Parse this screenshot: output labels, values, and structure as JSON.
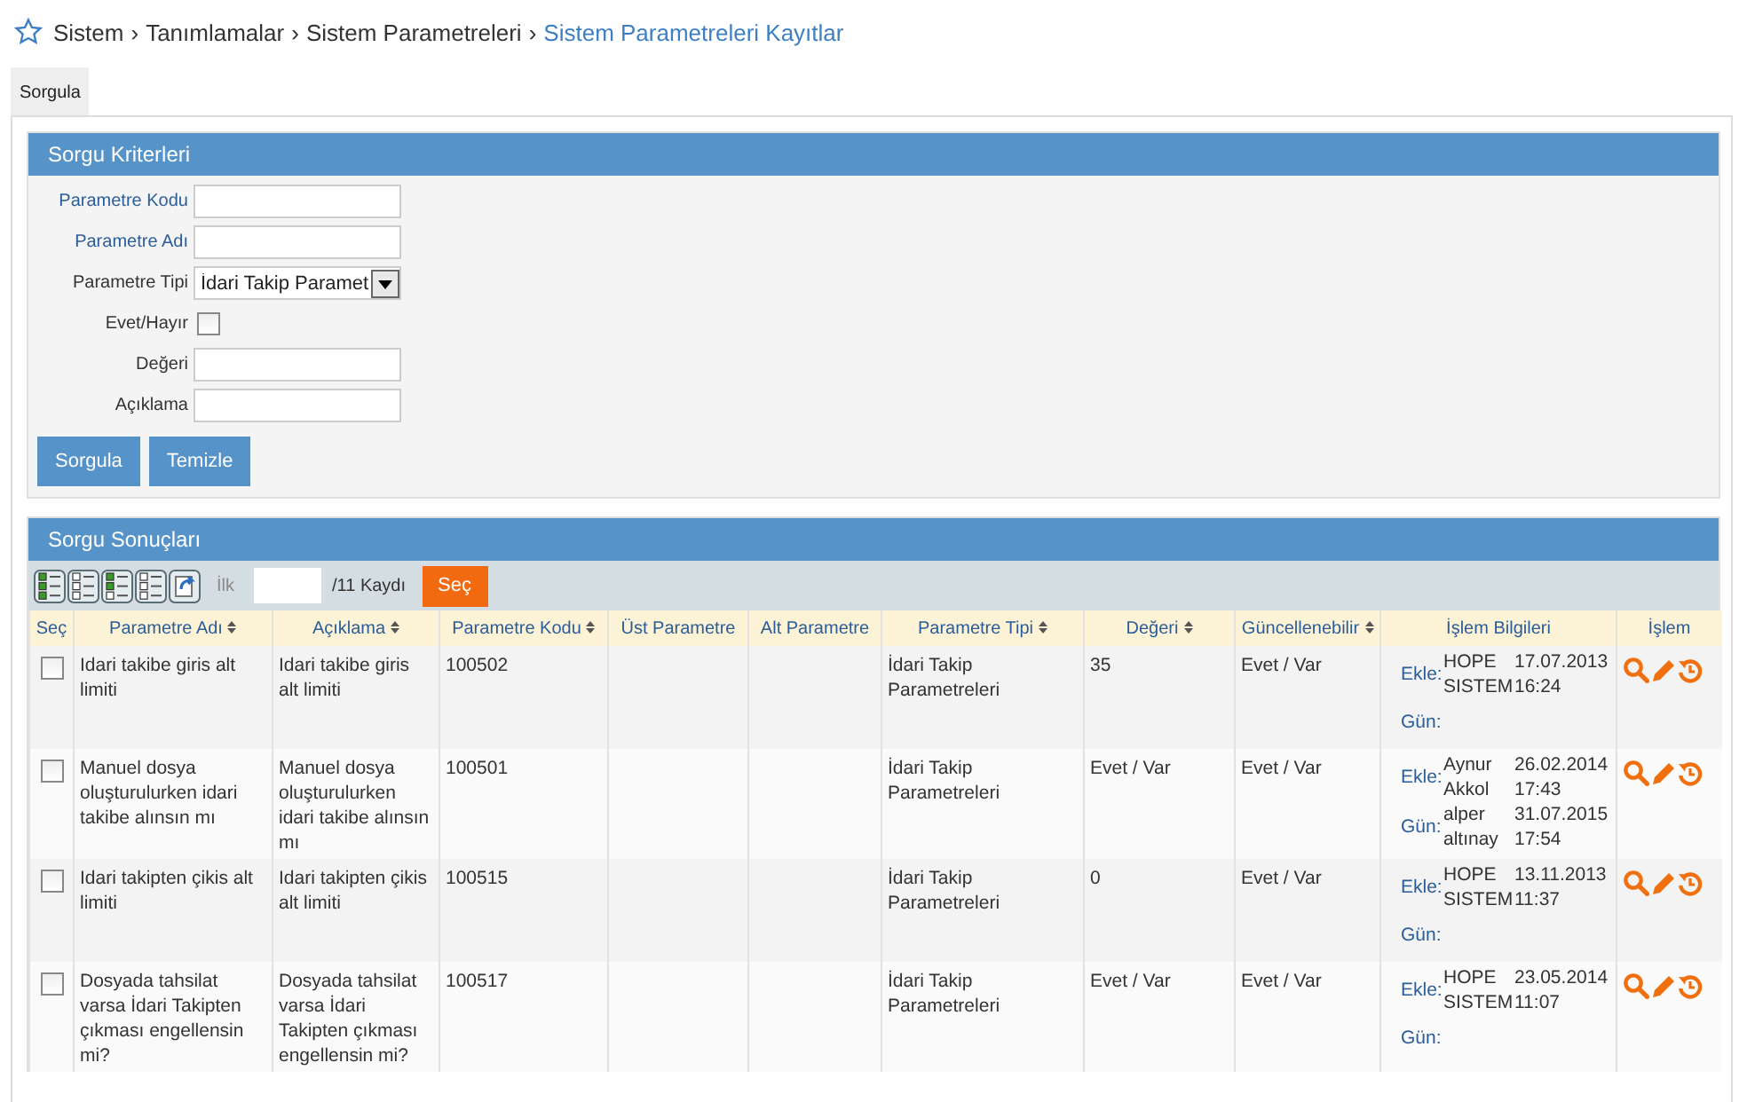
{
  "breadcrumb": [
    {
      "label": "Sistem",
      "current": false
    },
    {
      "sep": "›",
      "label": "Tanımlamalar",
      "current": false
    },
    {
      "sep": "›",
      "label": "Sistem Parametreleri",
      "current": false
    },
    {
      "sep": "›",
      "label": "Sistem Parametreleri Kayıtlar",
      "current": true
    }
  ],
  "tabs": [
    {
      "label": "Sorgula",
      "selected": true
    }
  ],
  "criteria": {
    "title": "Sorgu Kriterleri",
    "fields": [
      {
        "kind": "text",
        "label": "Parametre Kodu",
        "label_link": true
      },
      {
        "kind": "text",
        "label": "Parametre Adı",
        "label_link": true
      },
      {
        "kind": "select",
        "label": "Parametre Tipi",
        "label_link": false,
        "value": "İdari Takip Paramet"
      },
      {
        "kind": "checkbox",
        "label": "Evet/Hayır",
        "label_link": false,
        "checked": false
      },
      {
        "kind": "text",
        "label": "Değeri",
        "label_link": false
      },
      {
        "kind": "text",
        "label": "Açıklama",
        "label_link": false
      }
    ],
    "buttons": [
      "Sorgula",
      "Temizle"
    ]
  },
  "results": {
    "title": "Sorgu Sonuçları",
    "toolbar": {
      "first_label": "İlk",
      "total": "/11 Kaydı",
      "button": "Seç"
    },
    "columns": [
      {
        "label": "Seç",
        "sortable": false
      },
      {
        "label": "Parametre Adı",
        "sortable": true
      },
      {
        "label": "Açıklama",
        "sortable": true
      },
      {
        "label": "Parametre Kodu",
        "sortable": true
      },
      {
        "label": "Üst Parametre",
        "sortable": false
      },
      {
        "label": "Alt Parametre",
        "sortable": false
      },
      {
        "label": "Parametre Tipi",
        "sortable": true
      },
      {
        "label": "Değeri",
        "sortable": true
      },
      {
        "label": "Güncellenebilir",
        "sortable": true
      },
      {
        "label": "İşlem Bilgileri",
        "sortable": false
      },
      {
        "label": "İşlem",
        "sortable": false
      }
    ],
    "rows": [
      {
        "checked": false,
        "name": "Idari takibe giris alt limiti",
        "description": "Idari takibe giris alt limiti",
        "code": "100502",
        "type": "İdari Takip Parametreleri",
        "value": "35",
        "updatable": "Evet / Var",
        "added_label": "Ekle:",
        "added": {
          "user": "HOPE SISTEM",
          "date": "17.07.2013 16:24"
        },
        "updated_label": "Gün:"
      },
      {
        "checked": false,
        "name": "Manuel dosya oluşturulurken idari takibe alınsın mı",
        "description": "Manuel dosya oluşturulurken idari takibe alınsın mı",
        "code": "100501",
        "type": "İdari Takip Parametreleri",
        "value": "Evet / Var",
        "updatable": "Evet / Var",
        "added_label": "Ekle:",
        "added": {
          "user": "Aynur Akkol",
          "date": "26.02.2014 17:43"
        },
        "updated_label": "Gün:",
        "updated": {
          "user": "alper altınay",
          "date": "31.07.2015 17:54"
        }
      },
      {
        "checked": false,
        "name": "Idari takipten çikis alt limiti",
        "description": "Idari takipten çikis alt limiti",
        "code": "100515",
        "type": "İdari Takip Parametreleri",
        "value": "0",
        "updatable": "Evet / Var",
        "added_label": "Ekle:",
        "added": {
          "user": "HOPE SISTEM",
          "date": "13.11.2013 11:37"
        },
        "updated_label": "Gün:"
      },
      {
        "checked": false,
        "name": "Dosyada tahsilat varsa İdari Takipten çıkması engellensin mi?",
        "description": "Dosyada tahsilat varsa İdari Takipten çıkması engellensin mi?",
        "code": "100517",
        "type": "İdari Takip Parametreleri",
        "value": "Evet / Var",
        "updatable": "Evet / Var",
        "added_label": "Ekle:",
        "added": {
          "user": "HOPE SISTEM",
          "date": "23.05.2014 11:07"
        },
        "updated_label": "Gün:"
      }
    ]
  }
}
